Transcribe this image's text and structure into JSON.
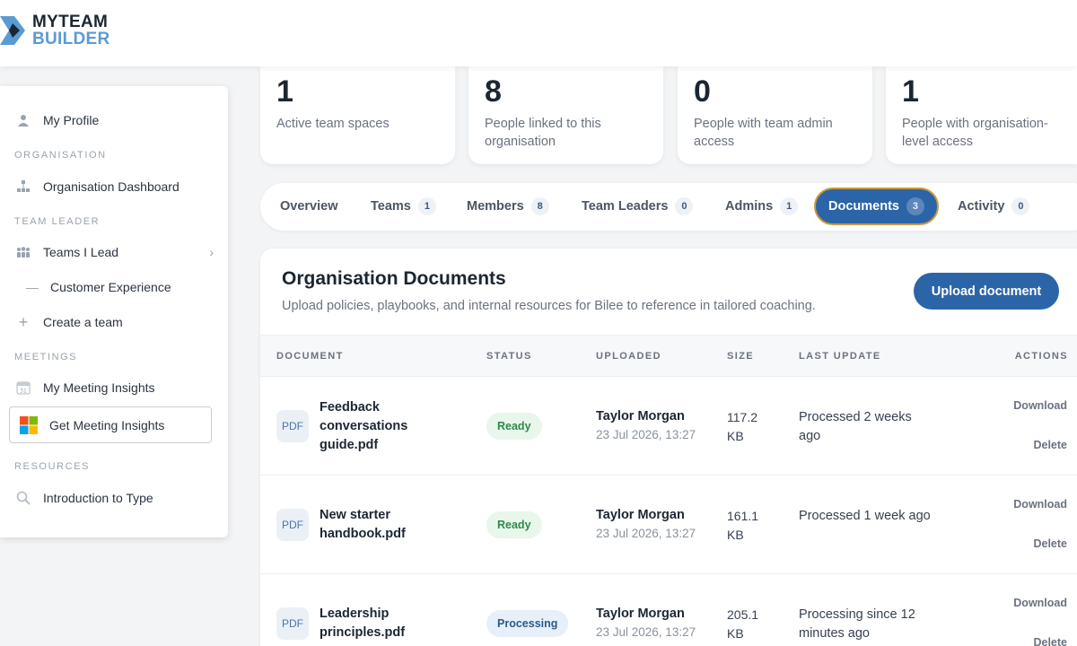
{
  "brand": {
    "line1": "MYTEAM",
    "line2": "BUILDER"
  },
  "sidebar": {
    "my_profile": "My Profile",
    "section_org": "ORGANISATION",
    "org_dashboard": "Organisation Dashboard",
    "section_team_leader": "TEAM LEADER",
    "teams_i_lead": "Teams I Lead",
    "customer_experience": "Customer Experience",
    "create_team": "Create a team",
    "section_meetings": "MEETINGS",
    "my_meeting_insights": "My Meeting Insights",
    "get_meeting_insights": "Get Meeting Insights",
    "section_resources": "RESOURCES",
    "intro_to_type": "Introduction to Type"
  },
  "stats": [
    {
      "value": "1",
      "label": "Active team spaces"
    },
    {
      "value": "8",
      "label": "People linked to this organisation"
    },
    {
      "value": "0",
      "label": "People with team admin access"
    },
    {
      "value": "1",
      "label": "People with organisation-level access"
    }
  ],
  "tabs": [
    {
      "label": "Overview",
      "count": ""
    },
    {
      "label": "Teams",
      "count": "1"
    },
    {
      "label": "Members",
      "count": "8"
    },
    {
      "label": "Team Leaders",
      "count": "0"
    },
    {
      "label": "Admins",
      "count": "1"
    },
    {
      "label": "Documents",
      "count": "3"
    },
    {
      "label": "Activity",
      "count": "0"
    }
  ],
  "docs": {
    "title": "Organisation Documents",
    "subtitle": "Upload policies, playbooks, and internal resources for Bilee to reference in tailored coaching.",
    "upload_label": "Upload document",
    "columns": [
      "DOCUMENT",
      "STATUS",
      "UPLOADED",
      "SIZE",
      "LAST UPDATE",
      "ACTIONS"
    ],
    "rows": [
      {
        "type": "PDF",
        "name": "Feedback conversations guide.pdf",
        "status": "Ready",
        "uploader": "Taylor Morgan",
        "date": "23 Jul 2026, 13:27",
        "size": "117.2 KB",
        "last_update": "Processed 2 weeks ago",
        "download": "Download",
        "delete": "Delete"
      },
      {
        "type": "PDF",
        "name": "New starter handbook.pdf",
        "status": "Ready",
        "uploader": "Taylor Morgan",
        "date": "23 Jul 2026, 13:27",
        "size": "161.1 KB",
        "last_update": "Processed 1 week ago",
        "download": "Download",
        "delete": "Delete"
      },
      {
        "type": "PDF",
        "name": "Leadership principles.pdf",
        "status": "Processing",
        "uploader": "Taylor Morgan",
        "date": "23 Jul 2026, 13:27",
        "size": "205.1 KB",
        "last_update": "Processing since 12 minutes ago",
        "download": "Download",
        "delete": "Delete"
      }
    ]
  },
  "colors": {
    "accent": "#2b65a7",
    "active_tab_border": "#c99a3f",
    "ready_text": "#2f8a4a",
    "ready_bg": "#e8f6ec",
    "processing_bg": "#e7eff8"
  },
  "icons": [
    "logo-icon",
    "person-icon",
    "org-chart-icon",
    "team-icon",
    "chevron-right-icon",
    "dash-icon",
    "plus-icon",
    "calendar-icon",
    "microsoft-icon",
    "search-icon",
    "pdf-icon"
  ]
}
